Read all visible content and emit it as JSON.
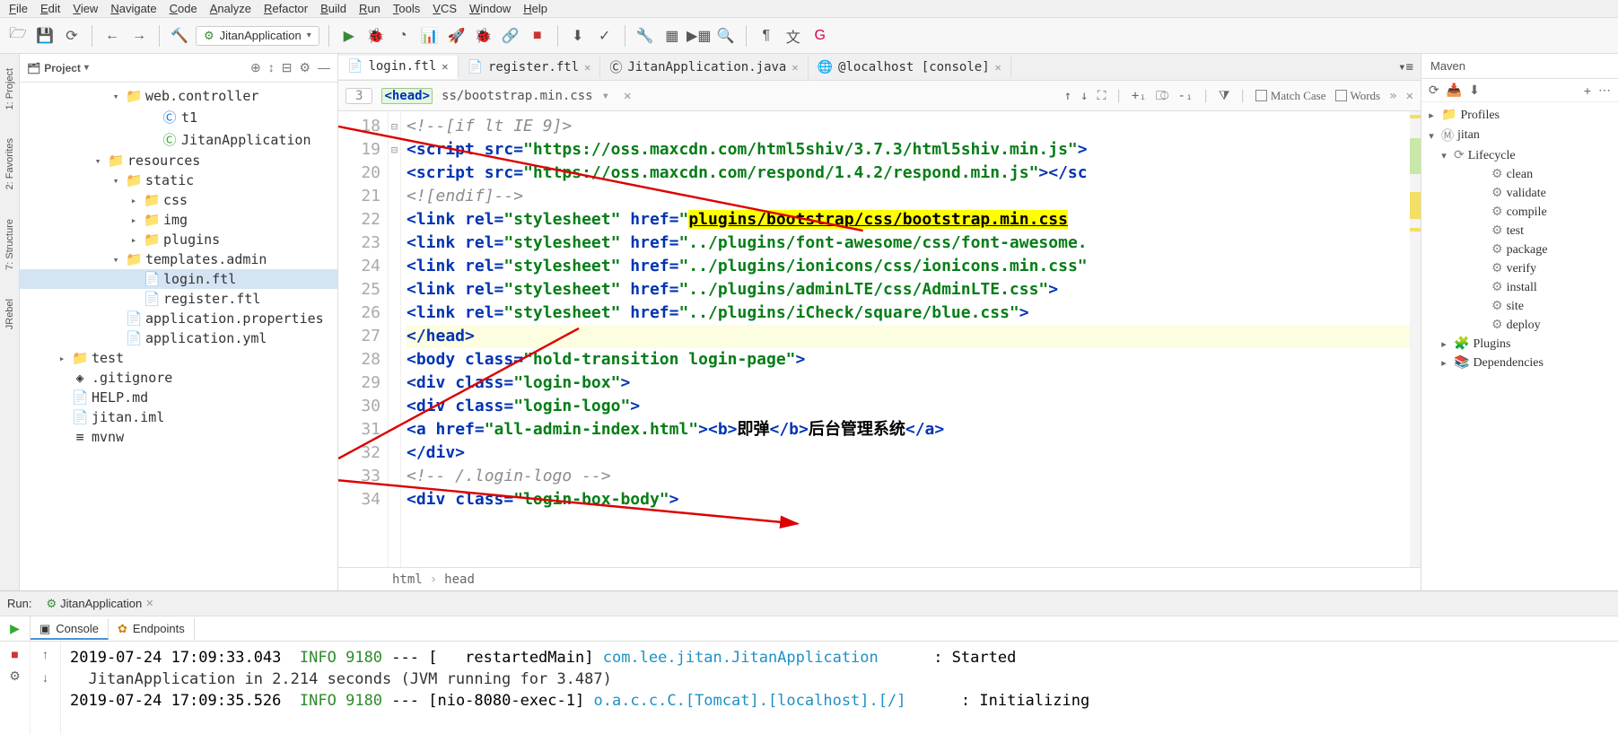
{
  "menu": [
    "File",
    "Edit",
    "View",
    "Navigate",
    "Code",
    "Analyze",
    "Refactor",
    "Build",
    "Run",
    "Tools",
    "VCS",
    "Window",
    "Help"
  ],
  "run_config": "JitanApplication",
  "left_tabs": [
    "1: Project",
    "2: Favorites",
    "7: Structure",
    "JRebel"
  ],
  "project": {
    "title": "Project",
    "nodes": [
      {
        "indent": "indent-3",
        "arrow": "▾",
        "icon": "📁",
        "label": "web.controller",
        "cls": ""
      },
      {
        "indent": "indent-5",
        "arrow": "",
        "icon": "Ⓒ",
        "label": "t1",
        "cls": "blue"
      },
      {
        "indent": "indent-5",
        "arrow": "",
        "icon": "Ⓒ",
        "label": "JitanApplication",
        "cls": "green-dot"
      },
      {
        "indent": "indent-2",
        "arrow": "▾",
        "icon": "📁",
        "label": "resources",
        "cls": ""
      },
      {
        "indent": "indent-3",
        "arrow": "▾",
        "icon": "📁",
        "label": "static",
        "cls": ""
      },
      {
        "indent": "indent-4",
        "arrow": "▸",
        "icon": "📁",
        "label": "css",
        "cls": ""
      },
      {
        "indent": "indent-4",
        "arrow": "▸",
        "icon": "📁",
        "label": "img",
        "cls": ""
      },
      {
        "indent": "indent-4",
        "arrow": "▸",
        "icon": "📁",
        "label": "plugins",
        "cls": ""
      },
      {
        "indent": "indent-3",
        "arrow": "▾",
        "icon": "📁",
        "label": "templates.admin",
        "cls": ""
      },
      {
        "indent": "indent-4",
        "arrow": "",
        "icon": "📄",
        "label": "login.ftl",
        "cls": "selected"
      },
      {
        "indent": "indent-4",
        "arrow": "",
        "icon": "📄",
        "label": "register.ftl",
        "cls": ""
      },
      {
        "indent": "indent-3",
        "arrow": "",
        "icon": "📄",
        "label": "application.properties",
        "cls": ""
      },
      {
        "indent": "indent-3",
        "arrow": "",
        "icon": "📄",
        "label": "application.yml",
        "cls": ""
      },
      {
        "indent": "indent-root",
        "arrow": "▸",
        "icon": "📁",
        "label": "test",
        "cls": ""
      },
      {
        "indent": "indent-root",
        "arrow": "",
        "icon": "◈",
        "label": ".gitignore",
        "cls": ""
      },
      {
        "indent": "indent-root",
        "arrow": "",
        "icon": "📄",
        "label": "HELP.md",
        "cls": ""
      },
      {
        "indent": "indent-root",
        "arrow": "",
        "icon": "📄",
        "label": "jitan.iml",
        "cls": ""
      },
      {
        "indent": "indent-root",
        "arrow": "",
        "icon": "≡",
        "label": "mvnw",
        "cls": ""
      }
    ]
  },
  "tabs": [
    {
      "icon": "📄",
      "label": "login.ftl",
      "active": true
    },
    {
      "icon": "📄",
      "label": "register.ftl",
      "active": false
    },
    {
      "icon": "Ⓒ",
      "label": "JitanApplication.java",
      "active": false
    },
    {
      "icon": "🌐",
      "label": "@localhost [console]",
      "active": false
    }
  ],
  "find": {
    "lineno": "3",
    "head_tag": "<head>",
    "path": "ss/bootstrap.min.css",
    "match_case": "Match Case",
    "words": "Words"
  },
  "code": {
    "lines": [
      18,
      19,
      20,
      21,
      22,
      23,
      24,
      25,
      26,
      27,
      28,
      29,
      30,
      31,
      32,
      33,
      34
    ],
    "breadcrumb": [
      "html",
      "head"
    ],
    "l18": "<!--[if lt IE 9]>",
    "l19_url": "https://oss.maxcdn.com/html5shiv/3.7.3/html5shiv.min.js",
    "l20_url": "https://oss.maxcdn.com/respond/1.4.2/respond.min.js",
    "l21": "<![endif]-->",
    "l22_href": "/plugins/bootstrap/css/bootstrap.min.css",
    "l23_href": "../plugins/font-awesome/css/font-awesome.",
    "l24_href": "../plugins/ionicons/css/ionicons.min.css",
    "l25_href": "../plugins/adminLTE/css/AdminLTE.css",
    "l26_href": "../plugins/iCheck/square/blue.css",
    "l28_class": "hold-transition login-page",
    "l29_class": "login-box",
    "l30_class": "login-logo",
    "l31_href": "all-admin-index.html",
    "l31_b": "即弹",
    "l31_txt": "后台管理系统",
    "l33": "<!-- /.login-logo -->",
    "l34_class": "login-box-body"
  },
  "maven": {
    "title": "Maven",
    "nodes": [
      {
        "lvl": "mv0",
        "arrow": "▸",
        "icon": "📁",
        "label": "Profiles"
      },
      {
        "lvl": "mv0",
        "arrow": "▾",
        "icon": "Ⓜ",
        "label": "jitan"
      },
      {
        "lvl": "mv1",
        "arrow": "▾",
        "icon": "⟳",
        "label": "Lifecycle"
      },
      {
        "lvl": "mv3",
        "arrow": "",
        "icon": "⚙",
        "label": "clean"
      },
      {
        "lvl": "mv3",
        "arrow": "",
        "icon": "⚙",
        "label": "validate"
      },
      {
        "lvl": "mv3",
        "arrow": "",
        "icon": "⚙",
        "label": "compile"
      },
      {
        "lvl": "mv3",
        "arrow": "",
        "icon": "⚙",
        "label": "test"
      },
      {
        "lvl": "mv3",
        "arrow": "",
        "icon": "⚙",
        "label": "package"
      },
      {
        "lvl": "mv3",
        "arrow": "",
        "icon": "⚙",
        "label": "verify"
      },
      {
        "lvl": "mv3",
        "arrow": "",
        "icon": "⚙",
        "label": "install"
      },
      {
        "lvl": "mv3",
        "arrow": "",
        "icon": "⚙",
        "label": "site"
      },
      {
        "lvl": "mv3",
        "arrow": "",
        "icon": "⚙",
        "label": "deploy"
      },
      {
        "lvl": "mv1",
        "arrow": "▸",
        "icon": "🧩",
        "label": "Plugins"
      },
      {
        "lvl": "mv1",
        "arrow": "▸",
        "icon": "📚",
        "label": "Dependencies"
      }
    ]
  },
  "run": {
    "label": "Run:",
    "app": "JitanApplication",
    "console": "Console",
    "endpoints": "Endpoints",
    "lines": [
      {
        "ts": "2019-07-24 17:09:33.043",
        "lvl": "INFO",
        "pid": "9180",
        "thr": "[   restartedMain]",
        "cls": "com.lee.jitan.JitanApplication",
        "msg": ": Started"
      },
      {
        "plain": "  JitanApplication in 2.214 seconds (JVM running for 3.487)"
      },
      {
        "ts": "2019-07-24 17:09:35.526",
        "lvl": "INFO",
        "pid": "9180",
        "thr": "[nio-8080-exec-1]",
        "cls": "o.a.c.c.C.[Tomcat].[localhost].[/]",
        "msg": ": Initializing"
      }
    ]
  }
}
